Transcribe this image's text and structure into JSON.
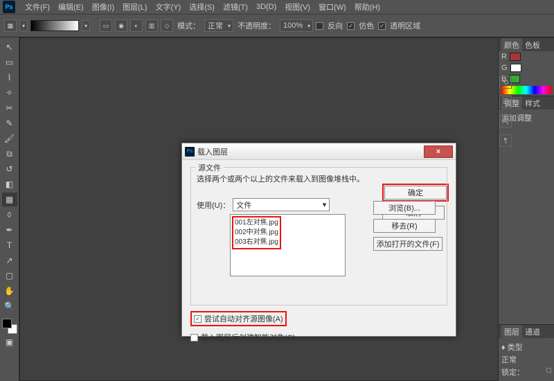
{
  "menu": {
    "file": "文件(F)",
    "edit": "编辑(E)",
    "image": "图像(I)",
    "layer": "图层(L)",
    "type": "文字(Y)",
    "select": "选择(S)",
    "filter": "滤镜(T)",
    "threeD": "3D(D)",
    "view": "视图(V)",
    "window": "窗口(W)",
    "help": "帮助(H)"
  },
  "options": {
    "mode_label": "模式：",
    "mode_value": "正常",
    "opacity_label": "不透明度：",
    "opacity_value": "100%",
    "reverse": "反向",
    "dither": "仿色",
    "transp": "透明区域"
  },
  "panels": {
    "color": {
      "tab1": "颜色",
      "tab2": "色板",
      "r": "R",
      "g": "G",
      "b": "B"
    },
    "adjust": {
      "tab1": "调整",
      "tab2": "样式",
      "add": "添加调整"
    },
    "layers": {
      "tab1": "图层",
      "tab2": "通道",
      "kind": "♦ 类型",
      "normal": "正常",
      "lock": "锁定：",
      "empty": "□"
    }
  },
  "dialog": {
    "title": "载入图层",
    "src_legend": "源文件",
    "src_desc": "选择两个或两个以上的文件来载入到图像堆栈中。",
    "use_label": "使用(U)：",
    "use_value": "文件",
    "files": [
      "001左对焦.jpg",
      "002中对焦.jpg",
      "003右对焦.jpg"
    ],
    "browse": "浏览(B)...",
    "remove": "移去(R)",
    "addopen": "添加打开的文件(F)",
    "autoalign": "尝试自动对齐源图像(A)",
    "smartobj": "载入图层后创建智能对象(C)",
    "ok": "确定",
    "cancel": "取消"
  }
}
